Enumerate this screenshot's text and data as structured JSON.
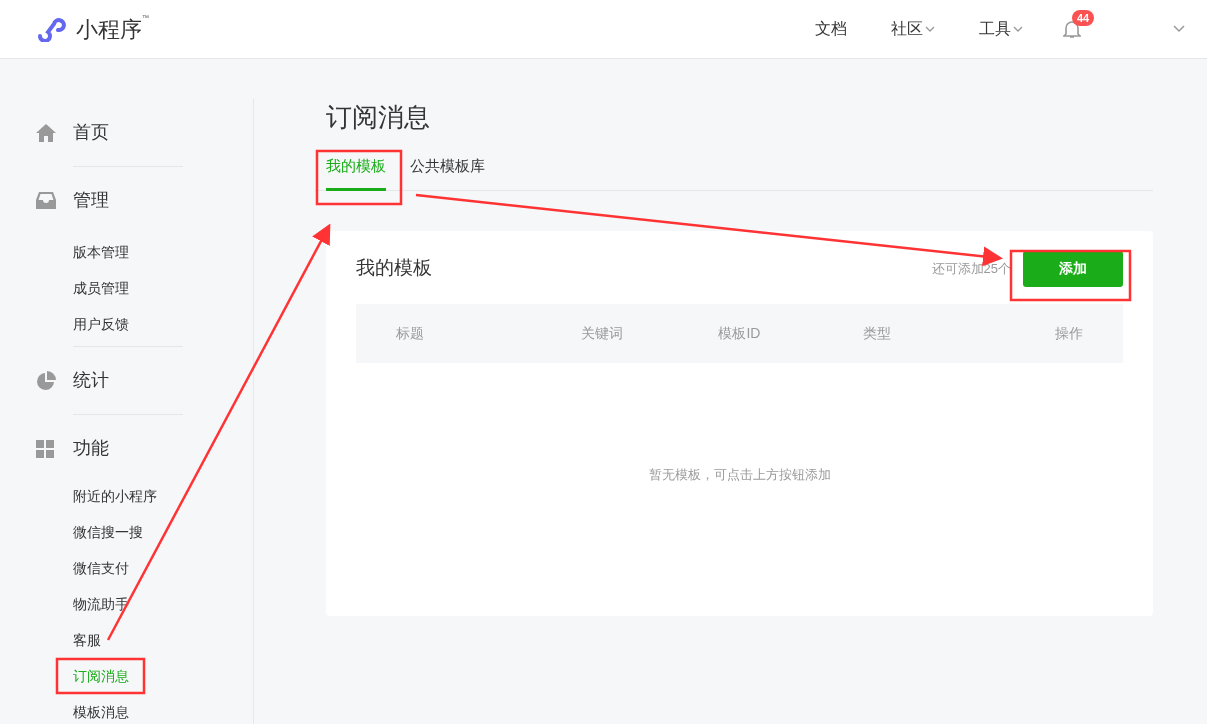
{
  "header": {
    "logo": "小程序",
    "trademark": "™",
    "nav": [
      {
        "label": "文档",
        "dropdown": false
      },
      {
        "label": "社区",
        "dropdown": true
      },
      {
        "label": "工具",
        "dropdown": true
      }
    ],
    "notification_count": "44"
  },
  "sidebar": [
    {
      "label": "首页"
    },
    {
      "label": "管理",
      "children": [
        {
          "label": "版本管理",
          "selected": false
        },
        {
          "label": "成员管理",
          "selected": false
        },
        {
          "label": "用户反馈",
          "selected": false
        }
      ]
    },
    {
      "label": "统计"
    },
    {
      "label": "功能",
      "children": [
        {
          "label": "附近的小程序",
          "selected": false
        },
        {
          "label": "微信搜一搜",
          "selected": false
        },
        {
          "label": "微信支付",
          "selected": false
        },
        {
          "label": "物流助手",
          "selected": false
        },
        {
          "label": "客服",
          "selected": false
        },
        {
          "label": "订阅消息",
          "selected": true
        },
        {
          "label": "模板消息",
          "selected": false
        }
      ]
    }
  ],
  "page_title": "订阅消息",
  "tabs": [
    {
      "label": "我的模板",
      "selected": true
    },
    {
      "label": "公共模板库",
      "selected": false
    }
  ],
  "card": {
    "title": "我的模板",
    "remaining": "还可添加25个",
    "add_button": "添加",
    "columns": [
      "标题",
      "关键词",
      "模板ID",
      "类型",
      "操作"
    ],
    "empty_text": "暂无模板，可点击上方按钮添加"
  }
}
